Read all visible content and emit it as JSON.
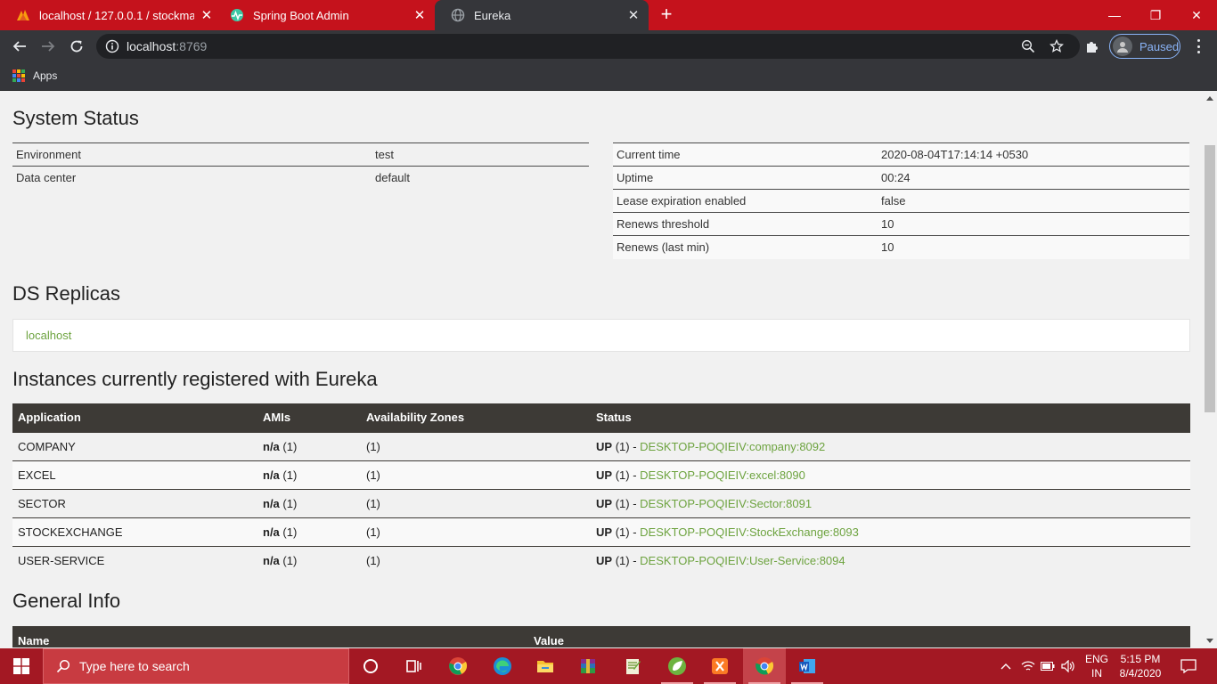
{
  "browser": {
    "tabs": [
      {
        "title": "localhost / 127.0.0.1 / stockmarke",
        "close": "✕"
      },
      {
        "title": "Spring Boot Admin",
        "close": "✕"
      },
      {
        "title": "Eureka",
        "close": "✕"
      }
    ],
    "new_tab": "+",
    "window_controls": {
      "minimize": "—",
      "restore": "❐",
      "close": "✕"
    },
    "url_host": "localhost",
    "url_port": ":8769",
    "profile_label": "Paused",
    "bookmarks": {
      "apps_label": "Apps"
    },
    "colors": {
      "tabstrip": "#c5121c",
      "toolbar": "#35363a",
      "omnibox": "#202124"
    }
  },
  "page": {
    "system_status": {
      "title": "System Status",
      "left": [
        {
          "key": "Environment",
          "value": "test"
        },
        {
          "key": "Data center",
          "value": "default"
        }
      ],
      "right": [
        {
          "key": "Current time",
          "value": "2020-08-04T17:14:14 +0530"
        },
        {
          "key": "Uptime",
          "value": "00:24"
        },
        {
          "key": "Lease expiration enabled",
          "value": "false"
        },
        {
          "key": "Renews threshold",
          "value": "10"
        },
        {
          "key": "Renews (last min)",
          "value": "10"
        }
      ]
    },
    "ds_replicas": {
      "title": "DS Replicas",
      "items": [
        "localhost"
      ]
    },
    "instances": {
      "title": "Instances currently registered with Eureka",
      "columns": [
        "Application",
        "AMIs",
        "Availability Zones",
        "Status"
      ],
      "rows": [
        {
          "application": "COMPANY",
          "amis_label": "n/a",
          "amis_count": "(1)",
          "zones": "(1)",
          "status": "UP",
          "status_count": "(1) -",
          "instance": "DESKTOP-POQIEIV:company:8092"
        },
        {
          "application": "EXCEL",
          "amis_label": "n/a",
          "amis_count": "(1)",
          "zones": "(1)",
          "status": "UP",
          "status_count": "(1) -",
          "instance": "DESKTOP-POQIEIV:excel:8090"
        },
        {
          "application": "SECTOR",
          "amis_label": "n/a",
          "amis_count": "(1)",
          "zones": "(1)",
          "status": "UP",
          "status_count": "(1) -",
          "instance": "DESKTOP-POQIEIV:Sector:8091"
        },
        {
          "application": "STOCKEXCHANGE",
          "amis_label": "n/a",
          "amis_count": "(1)",
          "zones": "(1)",
          "status": "UP",
          "status_count": "(1) -",
          "instance": "DESKTOP-POQIEIV:StockExchange:8093"
        },
        {
          "application": "USER-SERVICE",
          "amis_label": "n/a",
          "amis_count": "(1)",
          "zones": "(1)",
          "status": "UP",
          "status_count": "(1) -",
          "instance": "DESKTOP-POQIEIV:User-Service:8094"
        }
      ]
    },
    "general_info": {
      "title": "General Info",
      "columns": [
        "Name",
        "Value"
      ]
    },
    "colors": {
      "link": "#6da33f",
      "table_header": "#3d3a36",
      "background": "#f1f1f1"
    }
  },
  "taskbar": {
    "search_placeholder": "Type here to search",
    "apps": [
      "cortana-icon",
      "task-view-icon",
      "chrome-icon",
      "edge-icon",
      "file-explorer-icon",
      "winrar-icon",
      "notepad-plus-icon",
      "spring-tool-suite-icon",
      "xampp-icon",
      "chrome-icon",
      "word-icon"
    ],
    "tray": {
      "chevron": "^",
      "lang_line1": "ENG",
      "lang_line2": "IN",
      "time": "5:15 PM",
      "date": "8/4/2020"
    },
    "colors": {
      "taskbar": "#a31823",
      "search": "#c83b41"
    }
  }
}
